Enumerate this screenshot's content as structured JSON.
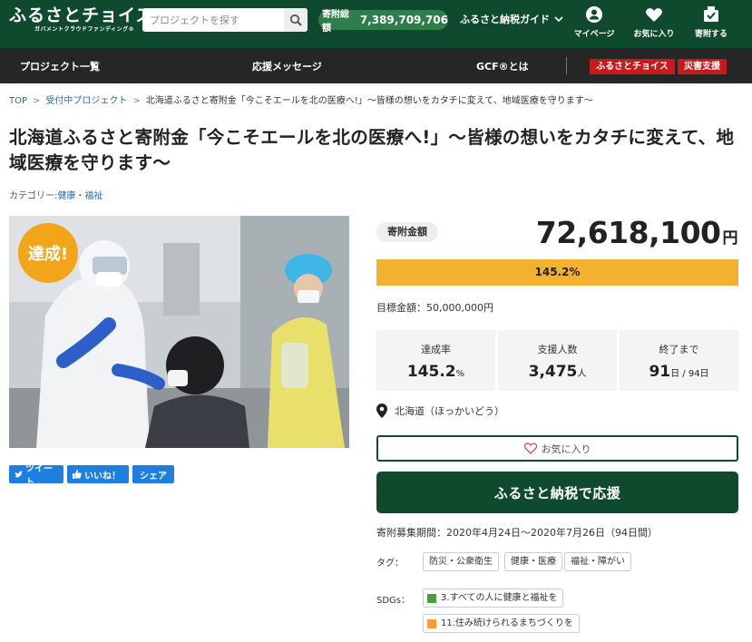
{
  "header": {
    "logo_main": "ふるさとチョイス",
    "logo_sub": "ガバメントクラウドファンディング®",
    "search_placeholder": "プロジェクトを探す",
    "total_label": "寄附総額",
    "total_value": "7,389,709,706",
    "guide_label": "ふるさと納税ガイド",
    "nav": [
      {
        "label": "マイページ",
        "icon": "user-icon"
      },
      {
        "label": "お気に入り",
        "icon": "heart-icon"
      },
      {
        "label": "寄附する",
        "icon": "donate-box-icon"
      }
    ]
  },
  "subnav": {
    "items": [
      "プロジェクト一覧",
      "応援メッセージ",
      "GCF®とは"
    ],
    "tags": [
      "ふるさとチョイス",
      "災害支援"
    ]
  },
  "breadcrumb": [
    "TOP",
    "受付中プロジェクト",
    "北海道ふるさと寄附金「今こそエールを北の医療へ!」〜皆様の想いをカタチに変えて、地域医療を守ります〜"
  ],
  "project": {
    "title": "北海道ふるさと寄附金「今こそエールを北の医療へ!」〜皆様の想いをカタチに変えて、地域医療を守ります〜",
    "category_label": "カテゴリー:",
    "category": "健康・福祉",
    "badge": "達成!"
  },
  "share": {
    "tweet": "ツイート",
    "like": "いいね！",
    "share": "シェア"
  },
  "funding": {
    "amount_label": "寄附金額",
    "amount": "72,618,100",
    "currency": "円",
    "progress_text": "145.2%",
    "progress_fraction": 1.0,
    "goal_text": "目標金額：50,000,000円",
    "stats": [
      {
        "label": "達成率",
        "value": "145.2",
        "unit": "%"
      },
      {
        "label": "支援人数",
        "value": "3,475",
        "unit": "人"
      },
      {
        "label": "終了まで",
        "value": "91",
        "unit": "日 / 94日"
      }
    ],
    "location": "北海道（ほっかいどう）",
    "favorite_label": "お気に入り",
    "donate_label": "ふるさと納税で応援",
    "period": "寄附募集期間：2020年4月24日〜2020年7月26日（94日間）"
  },
  "tags_label": "タグ：",
  "tags": [
    "防災・公衆衛生",
    "健康・医療",
    "福祉・障がい"
  ],
  "sdgs_label": "SDGs：",
  "sdgs": [
    {
      "label": "3.すべての人に健康と福祉を",
      "color": "#4c9f38"
    },
    {
      "label": "11.住み続けられるまちづくりを",
      "color": "#fd9d24"
    }
  ],
  "colors": {
    "brand_green": "#0f4a2e",
    "progress": "#f2b131",
    "badge_orange": "#f3a51a",
    "red_tag": "#c8191b",
    "link_blue": "#2a6aab"
  }
}
